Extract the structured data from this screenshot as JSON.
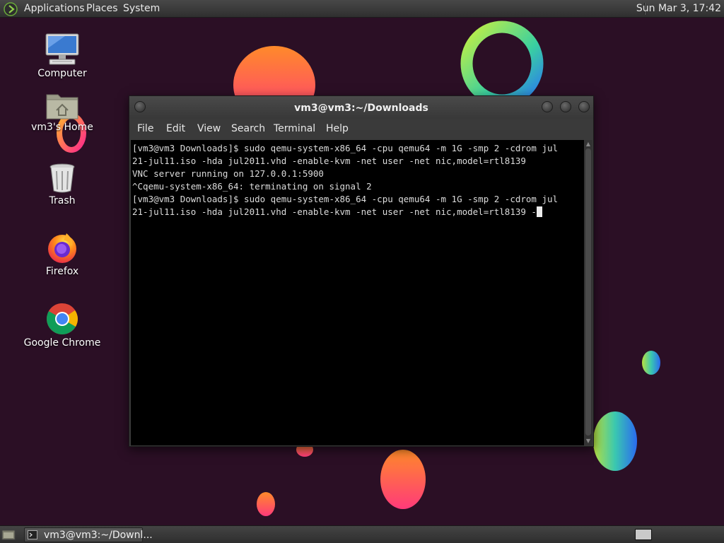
{
  "top_panel": {
    "menus": [
      "Applications",
      "Places",
      "System"
    ],
    "clock": "Sun Mar  3, 17:42"
  },
  "desktop_icons": [
    {
      "label": "Computer",
      "icon": "computer-icon"
    },
    {
      "label": "vm3's Home",
      "icon": "home-folder-icon"
    },
    {
      "label": "Trash",
      "icon": "trash-icon"
    },
    {
      "label": "Firefox",
      "icon": "firefox-icon"
    },
    {
      "label": "Google Chrome",
      "icon": "chrome-icon"
    }
  ],
  "terminal": {
    "title": "vm3@vm3:~/Downloads",
    "menu": [
      "File",
      "Edit",
      "View",
      "Search",
      "Terminal",
      "Help"
    ],
    "lines": [
      "[vm3@vm3 Downloads]$ sudo qemu-system-x86_64 -cpu qemu64 -m 1G -smp 2 -cdrom jul",
      "21-jul11.iso -hda jul2011.vhd -enable-kvm -net user -net nic,model=rtl8139",
      "VNC server running on 127.0.0.1:5900",
      "^Cqemu-system-x86_64: terminating on signal 2",
      "[vm3@vm3 Downloads]$ sudo qemu-system-x86_64 -cpu qemu64 -m 1G -smp 2 -cdrom jul",
      "21-jul11.iso -hda jul2011.vhd -enable-kvm -net user -net nic,model=rtl8139 -"
    ]
  },
  "taskbar": {
    "window_button": "vm3@vm3:~/Downl..."
  },
  "colors": {
    "desktop_bg": "#2b0f25",
    "terminal_bg": "#000000",
    "terminal_fg": "#dcdcdc",
    "panel_bg": "#3a3a3a"
  }
}
